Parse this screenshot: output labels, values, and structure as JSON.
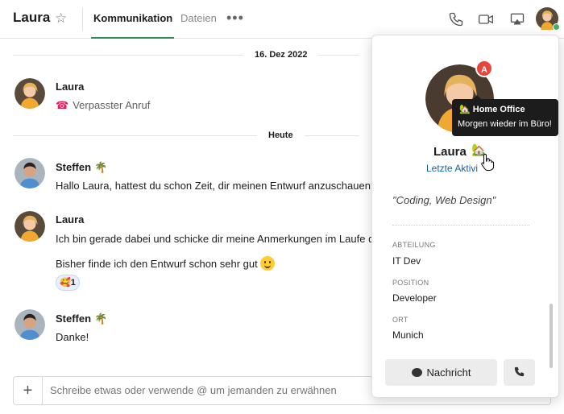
{
  "header": {
    "title": "Laura",
    "tabs": [
      {
        "label": "Kommunikation",
        "active": true
      },
      {
        "label": "Dateien",
        "active": false
      }
    ],
    "more_label": "•••",
    "icons": [
      "star-icon",
      "phone-icon",
      "video-icon",
      "screen-share-icon",
      "avatar"
    ]
  },
  "chat": {
    "date_1": "16. Dez 2022",
    "date_2": "Heute",
    "messages": [
      {
        "sender": "Laura",
        "missed_call": "Verpasster Anruf"
      },
      {
        "sender": "Steffen",
        "sender_emoji": "🌴",
        "text": "Hallo Laura, hattest du schon Zeit, dir meinen Entwurf anzuschauen?"
      },
      {
        "sender": "Laura",
        "text": "Ich bin gerade dabei und schicke dir meine Anmerkungen im Laufe de",
        "text_2": "Bisher finde ich den Entwurf schon sehr gut",
        "reaction_count": "1",
        "reaction_emoji": "🥰"
      },
      {
        "sender": "Steffen",
        "sender_emoji": "🌴",
        "text": "Danke!"
      }
    ]
  },
  "composer": {
    "plus_label": "+",
    "placeholder": "Schreibe etwas oder verwende @ um jemanden zu erwähnen"
  },
  "profile": {
    "badge": "A",
    "name": "Laura",
    "name_emoji": "🏡",
    "last_active": "Letzte Aktivi",
    "quote": "\"Coding, Web Design\"",
    "fields": [
      {
        "label": "ABTEILUNG",
        "value": "IT Dev"
      },
      {
        "label": "POSITION",
        "value": "Developer"
      },
      {
        "label": "ORT",
        "value": "Munich"
      }
    ],
    "message_button": "Nachricht"
  },
  "tooltip": {
    "title": "Home Office",
    "title_emoji": "🏡",
    "subtitle": "Morgen wieder im Büro!"
  },
  "colors": {
    "accent_green": "#2e8b57",
    "link_blue": "#1264a3",
    "badge_red": "#e8453c",
    "online_green": "#3bb55d",
    "missed_red": "#e01e5a"
  }
}
